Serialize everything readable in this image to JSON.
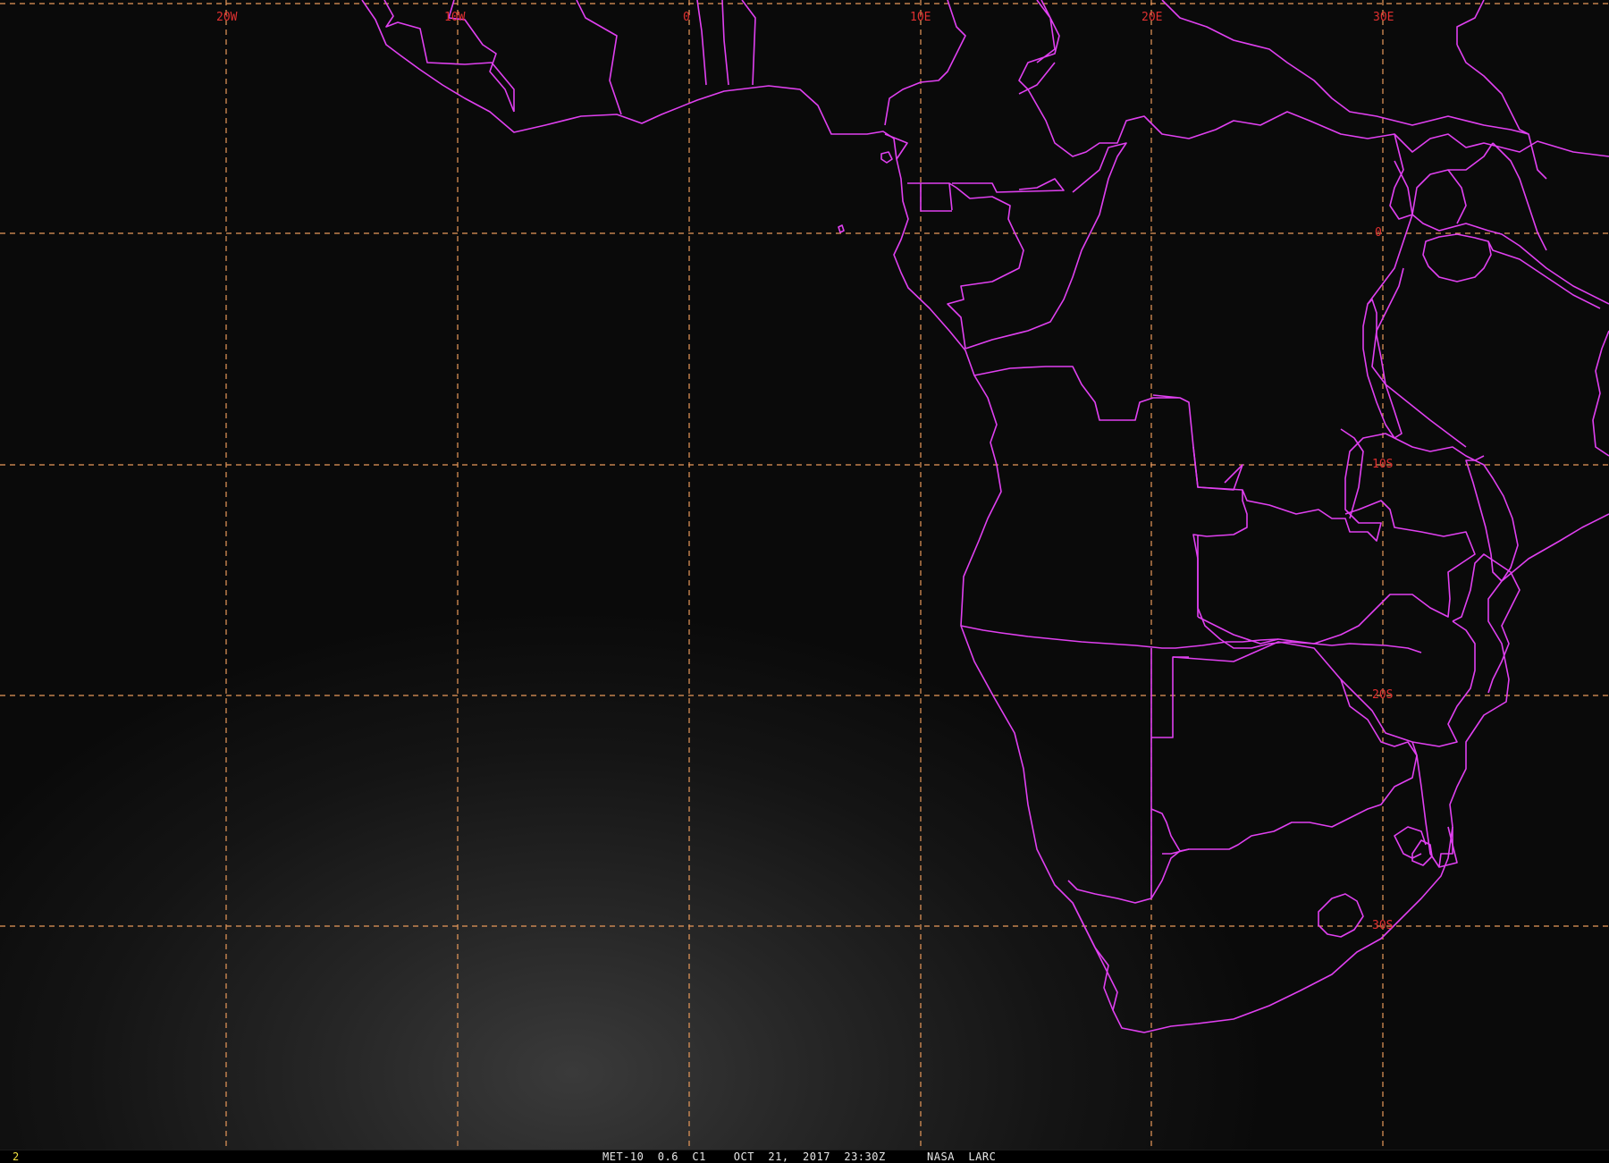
{
  "map": {
    "longitude_labels": [
      "20W",
      "10W",
      "0",
      "10E",
      "20E",
      "30E"
    ],
    "latitude_labels": [
      "0",
      "10S",
      "20S",
      "30S"
    ],
    "colors": {
      "coastline": "#e040f0",
      "graticule": "#e8995a",
      "grid_label": "#e03030",
      "frame_number": "#f0e040"
    }
  },
  "footer": {
    "frame_number": "2",
    "caption": "MET-10  0.6  C1    OCT  21,  2017  23:30Z      NASA  LARC"
  }
}
